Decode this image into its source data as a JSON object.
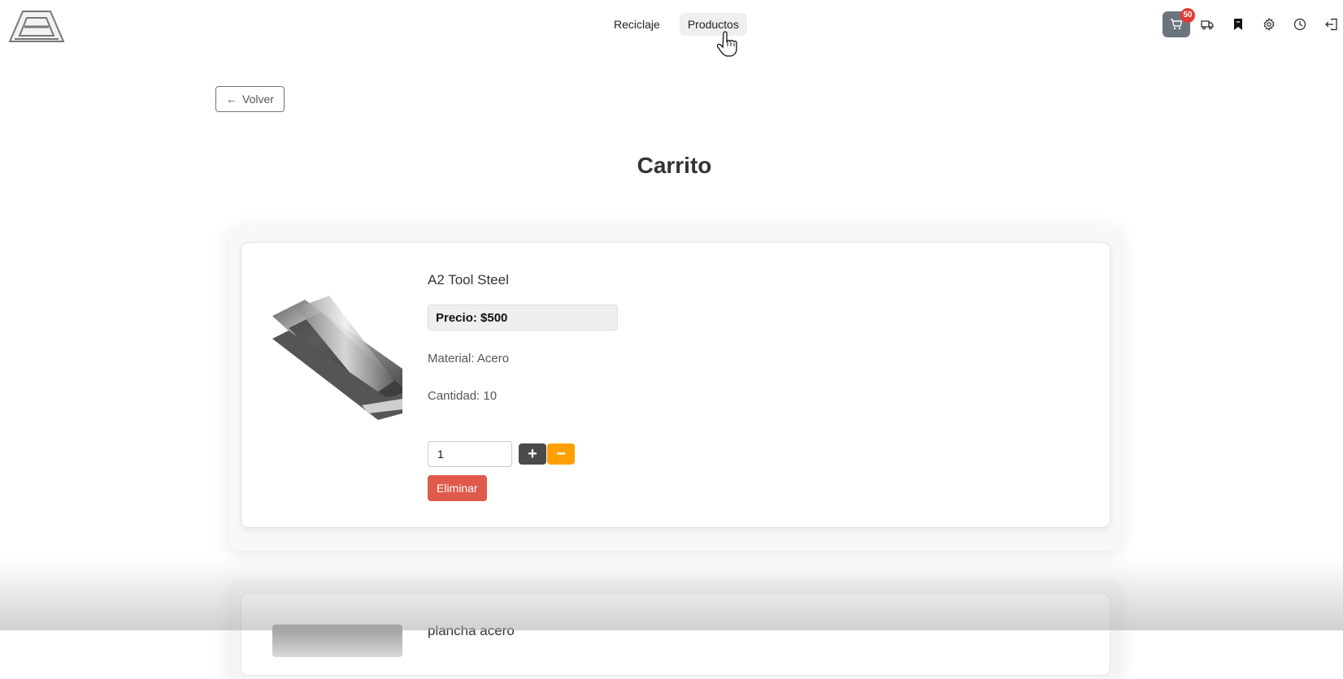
{
  "nav": {
    "links": [
      {
        "label": "Reciclaje"
      },
      {
        "label": "Productos"
      }
    ]
  },
  "header_icons": {
    "cart": {
      "icon": "cart-icon",
      "badge": "50",
      "color": "#6c757d"
    },
    "items": [
      "truck-icon",
      "bookmark-icon",
      "gear-icon",
      "clock-icon",
      "logout-icon"
    ]
  },
  "back_button": {
    "label": "Volver",
    "icon": "arrow-left-icon"
  },
  "page_title": "Carrito",
  "cart_items": [
    {
      "name": "A2 Tool Steel",
      "price_label": "Precio: $500",
      "material_label": "Material: Acero",
      "quantity_label": "Cantidad: 10",
      "qty_value": "1",
      "plus_label": "+",
      "minus_label": "−",
      "delete_label": "Eliminar"
    },
    {
      "name": "plancha acero"
    }
  ],
  "colors": {
    "delete": "#e05a4b",
    "minus": "#ff9f00",
    "plus": "#4a4a4a",
    "badge": "#e53935"
  }
}
